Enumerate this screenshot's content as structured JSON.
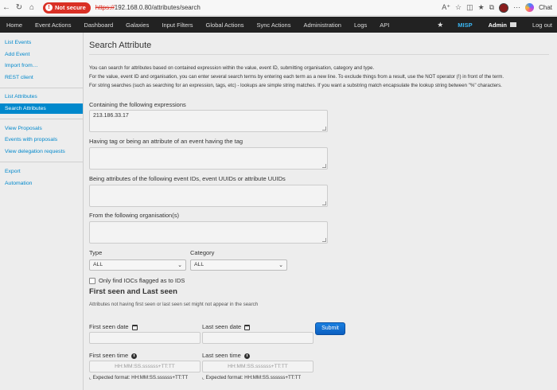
{
  "browser": {
    "not_secure_label": "Not secure",
    "url_scheme": "https://",
    "url_rest": "192.168.0.80/attributes/search",
    "chat_label": "Chat"
  },
  "navbar": {
    "items": [
      "Home",
      "Event Actions",
      "Dashboard",
      "Galaxies",
      "Input Filters",
      "Global Actions",
      "Sync Actions",
      "Administration",
      "Logs",
      "API"
    ],
    "brand": "MISP",
    "user": "Admin",
    "logout": "Log out"
  },
  "sidebar": {
    "items": [
      "List Events",
      "Add Event",
      "Import from…",
      "REST client",
      "List Attributes",
      "Search Attributes",
      "View Proposals",
      "Events with proposals",
      "View delegation requests",
      "Export",
      "Automation"
    ],
    "active": "Search Attributes"
  },
  "main": {
    "title": "Search Attribute",
    "desc1": "You can search for attributes based on contained expression within the value, event ID, submitting organisation, category and type.",
    "desc2": "For the value, event ID and organisation, you can enter several search terms by entering each term as a new line. To exclude things from a result, use the NOT operator (!) in front of the term.",
    "desc3": "For string searches (such as searching for an expression, tags, etc) - lookups are simple string matches. If you want a substring match encapsulate the lookup string between \"%\" characters.",
    "expressions_label": "Containing the following expressions",
    "expressions_value": "213.186.33.17",
    "tag_label": "Having tag or being an attribute of an event having the tag",
    "ids_label": "Being attributes of the following event IDs, event UUIDs or attribute UUIDs",
    "org_label": "From the following organisation(s)",
    "type_label": "Type",
    "type_value": "ALL",
    "category_label": "Category",
    "category_value": "ALL",
    "ioc_label": "Only find IOCs flagged as to IDS",
    "seen_title": "First seen and Last seen",
    "seen_note": "Attributes not having first seen or last seen set might not appear in the search",
    "first_seen_date_label": "First seen date",
    "last_seen_date_label": "Last seen date",
    "submit_label": "Submit",
    "first_seen_time_label": "First seen time",
    "last_seen_time_label": "Last seen time",
    "time_placeholder": "HH:MM:SS.ssssss+TT:TT",
    "expected_format": "Expected format: HH:MM:SS.ssssss+TT:TT"
  },
  "colors": {
    "navbar_bg": "#222222",
    "brand": "#3ab6f2",
    "link": "#0088cc",
    "active_bg": "#0088cc",
    "insecure": "#d93025",
    "submit": "#0b5fc0"
  }
}
